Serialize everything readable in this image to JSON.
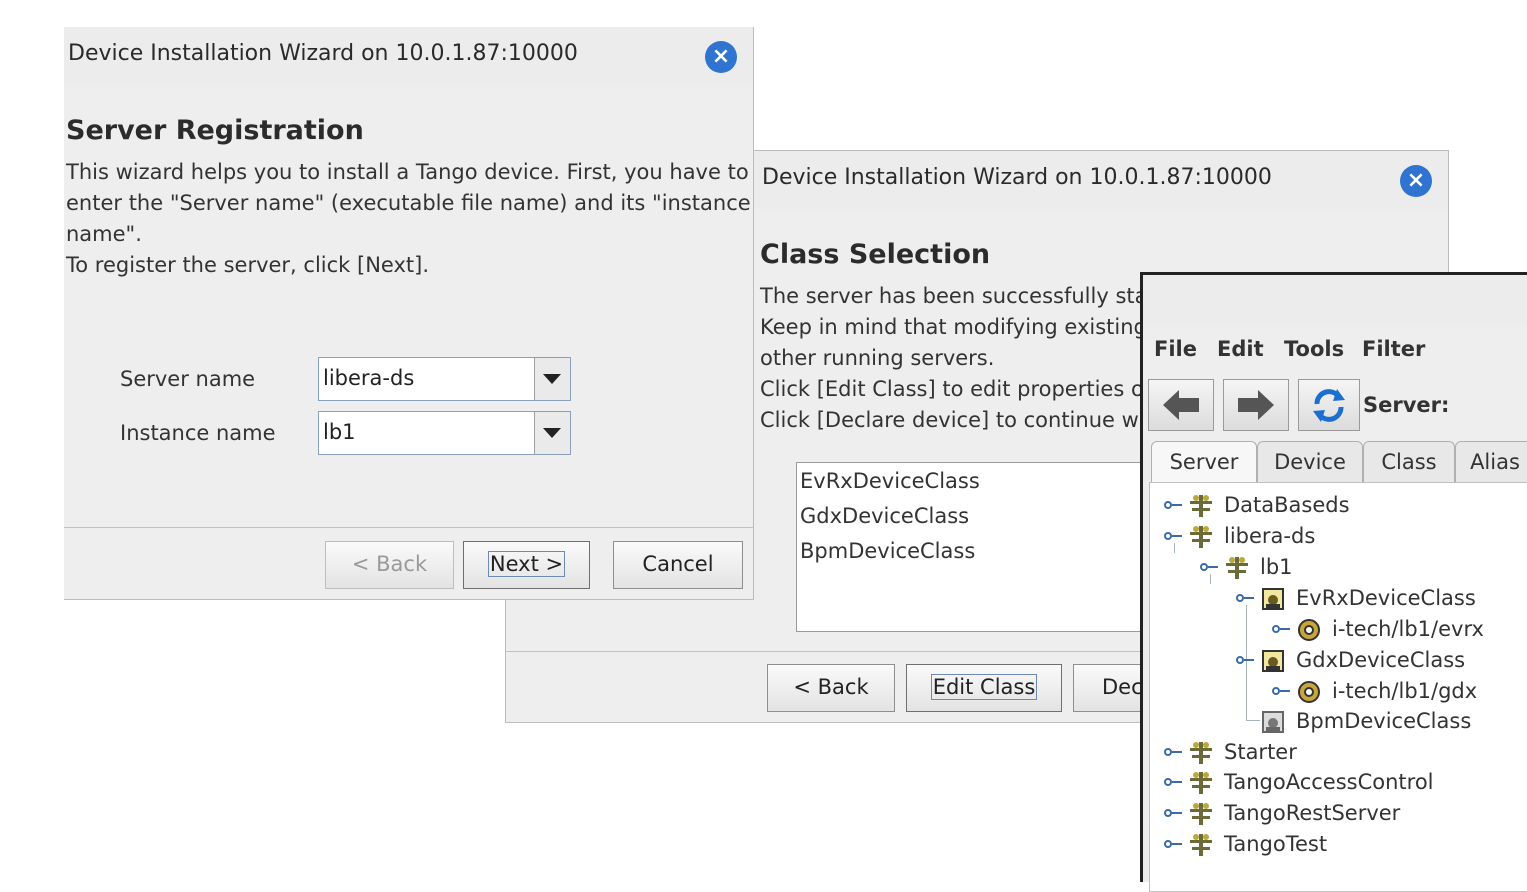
{
  "wizard1": {
    "title": "Device Installation Wizard on 10.0.1.87:10000",
    "heading": "Server Registration",
    "description": [
      "This wizard helps you to install a Tango device. First, you have to",
      "enter the \"Server name\" (executable file name) and its \"instance",
      "name\".",
      "To register the server, click [Next]."
    ],
    "server_name_label": "Server name",
    "server_name_value": "libera-ds",
    "instance_name_label": "Instance name",
    "instance_name_value": "lb1",
    "back_label": "< Back",
    "next_label": "Next >",
    "cancel_label": "Cancel"
  },
  "wizard2": {
    "title": "Device Installation Wizard on 10.0.1.87:10000",
    "heading": "Class Selection",
    "description": [
      "The server has been successfully star",
      "Keep in mind that modifying existing c",
      "other running servers.",
      "Click [Edit Class] to edit properties of t",
      "Click [Declare device] to continue with"
    ],
    "classes": [
      "EvRxDeviceClass",
      "GdxDeviceClass",
      "BpmDeviceClass"
    ],
    "back_label": "< Back",
    "edit_class_label": "Edit Class",
    "declare_label": "Dec"
  },
  "jive": {
    "menu": [
      "File",
      "Edit",
      "Tools",
      "Filter"
    ],
    "server_label": "Server:",
    "tabs": [
      "Server",
      "Device",
      "Class",
      "Alias"
    ],
    "tree": [
      "DataBaseds",
      "libera-ds",
      "lb1",
      "EvRxDeviceClass",
      "i-tech/lb1/evrx",
      "GdxDeviceClass",
      "i-tech/lb1/gdx",
      "BpmDeviceClass",
      "Starter",
      "TangoAccessControl",
      "TangoRestServer",
      "TangoTest"
    ]
  },
  "colors": {
    "accent": "#2f74d0",
    "window_bg": "#eeeeee"
  }
}
